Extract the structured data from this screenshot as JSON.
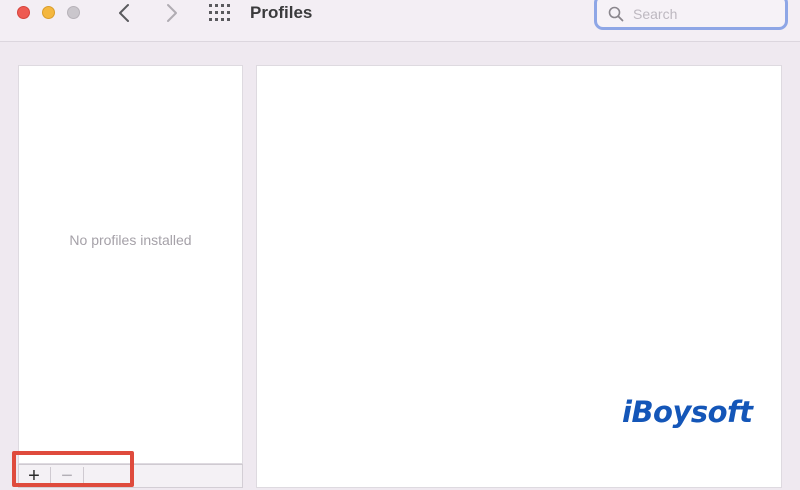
{
  "window": {
    "title": "Profiles",
    "colors": {
      "close": "#ee5a52",
      "minimize": "#f4b73f",
      "zoom": "#cac6cc"
    }
  },
  "toolbar": {
    "back_icon": "chevron-left-icon",
    "forward_icon": "chevron-right-icon",
    "grid_icon": "grid-icon"
  },
  "search": {
    "placeholder": "Search",
    "value": ""
  },
  "profiles_list": {
    "empty_message": "No profiles installed",
    "add_label": "+",
    "remove_label": "−"
  },
  "watermark": {
    "text": "iBoysoft",
    "color": "#1456b8"
  },
  "highlight": {
    "color": "#df4b3d"
  }
}
